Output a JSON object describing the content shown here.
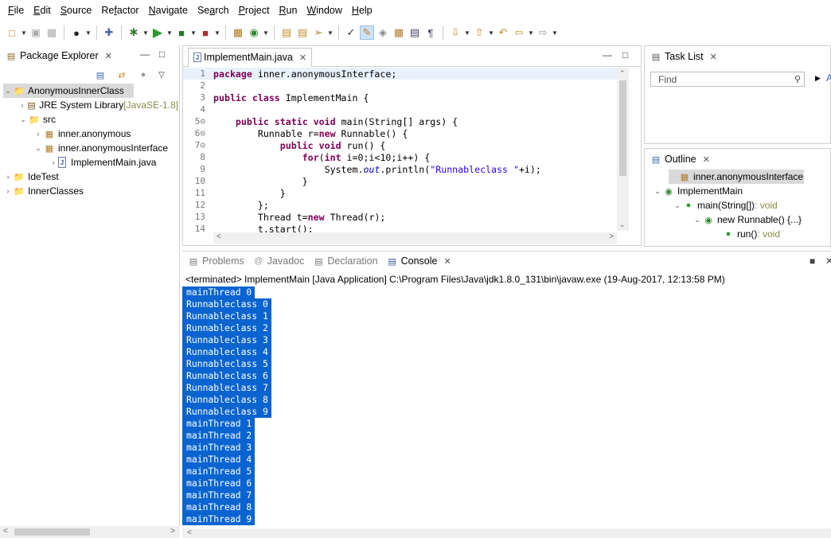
{
  "menu": [
    "File",
    "Edit",
    "Source",
    "Refactor",
    "Navigate",
    "Search",
    "Project",
    "Run",
    "Window",
    "Help"
  ],
  "menu_mnemonics": [
    "F",
    "E",
    "S",
    "f",
    "N",
    "a",
    "P",
    "R",
    "W",
    "H"
  ],
  "package_explorer": {
    "title": "Package Explorer",
    "items": [
      {
        "label": "AnonymousInnerClass",
        "level": 0,
        "expanded": true,
        "selected": true,
        "icon": "project-icon"
      },
      {
        "label": "JRE System Library",
        "suffix": "[JavaSE-1.8]",
        "level": 1,
        "expanded": false,
        "icon": "library-icon"
      },
      {
        "label": "src",
        "level": 1,
        "expanded": true,
        "icon": "source-folder-icon"
      },
      {
        "label": "inner.anonymous",
        "level": 2,
        "expanded": false,
        "icon": "package-icon"
      },
      {
        "label": "inner.anonymousInterface",
        "level": 2,
        "expanded": true,
        "icon": "package-icon"
      },
      {
        "label": "ImplementMain.java",
        "level": 3,
        "expanded": false,
        "icon": "java-file-icon"
      },
      {
        "label": "IdeTest",
        "level": 0,
        "expanded": false,
        "icon": "project-icon"
      },
      {
        "label": "InnerClasses",
        "level": 0,
        "expanded": false,
        "icon": "project-icon"
      }
    ]
  },
  "editor": {
    "tab": "ImplementMain.java",
    "lines": [
      {
        "n": "1",
        "html": "<span class=\"kw\">package</span> inner.anonymousInterface;"
      },
      {
        "n": "2",
        "html": ""
      },
      {
        "n": "3",
        "html": "<span class=\"kw\">public</span> <span class=\"kw\">class</span> ImplementMain {"
      },
      {
        "n": "4",
        "html": ""
      },
      {
        "n": "5⊝",
        "html": "    <span class=\"kw\">public</span> <span class=\"kw\">static</span> <span class=\"kw\">void</span> main(String[] args) {"
      },
      {
        "n": "6⊝",
        "html": "        Runnable r=<span class=\"kw\">new</span> Runnable() {"
      },
      {
        "n": "7⊝",
        "html": "            <span class=\"kw\">public</span> <span class=\"kw\">void</span> run() {"
      },
      {
        "n": "8",
        "html": "                <span class=\"kw\">for</span>(<span class=\"kw\">int</span> i=0;i&lt;10;i++) {"
      },
      {
        "n": "9",
        "html": "                    System.<span class=\"ital\">out</span>.println(<span class=\"str\">\"Runnableclass \"</span>+i);"
      },
      {
        "n": "10",
        "html": "                }"
      },
      {
        "n": "11",
        "html": "            }"
      },
      {
        "n": "12",
        "html": "        };"
      },
      {
        "n": "13",
        "html": "        Thread t=<span class=\"kw\">new</span> Thread(r);"
      },
      {
        "n": "14",
        "html": "        t.start();"
      }
    ]
  },
  "task_list": {
    "title": "Task List",
    "find_placeholder": "Find",
    "more": "A"
  },
  "outline": {
    "title": "Outline",
    "items": [
      {
        "label": "inner.anonymousInterface",
        "level": 0,
        "icon": "package-icon",
        "selected": true
      },
      {
        "label": "ImplementMain",
        "level": 0,
        "icon": "class-icon",
        "expanded": true
      },
      {
        "label": "main(String[])",
        "suffix": " : void",
        "level": 1,
        "icon": "method-static-icon",
        "expanded": true
      },
      {
        "label": "new Runnable() {...}",
        "level": 2,
        "icon": "anon-class-icon",
        "expanded": true
      },
      {
        "label": "run()",
        "suffix": " : void",
        "level": 3,
        "icon": "method-icon"
      }
    ]
  },
  "console": {
    "tabs": [
      "Problems",
      "Javadoc",
      "Declaration",
      "Console"
    ],
    "active_tab": "Console",
    "header": "<terminated> ImplementMain [Java Application] C:\\Program Files\\Java\\jdk1.8.0_131\\bin\\javaw.exe (19-Aug-2017, 12:13:58 PM)",
    "output": [
      "mainThread 0",
      "Runnableclass 0",
      "Runnableclass 1",
      "Runnableclass 2",
      "Runnableclass 3",
      "Runnableclass 4",
      "Runnableclass 5",
      "Runnableclass 6",
      "Runnableclass 7",
      "Runnableclass 8",
      "Runnableclass 9",
      "mainThread 1",
      "mainThread 2",
      "mainThread 3",
      "mainThread 4",
      "mainThread 5",
      "mainThread 6",
      "mainThread 7",
      "mainThread 8",
      "mainThread 9"
    ]
  },
  "colors": {
    "selection": "#0a64d0",
    "keyword": "#7f0055",
    "string": "#2a00ff",
    "field": "#0000c0"
  }
}
